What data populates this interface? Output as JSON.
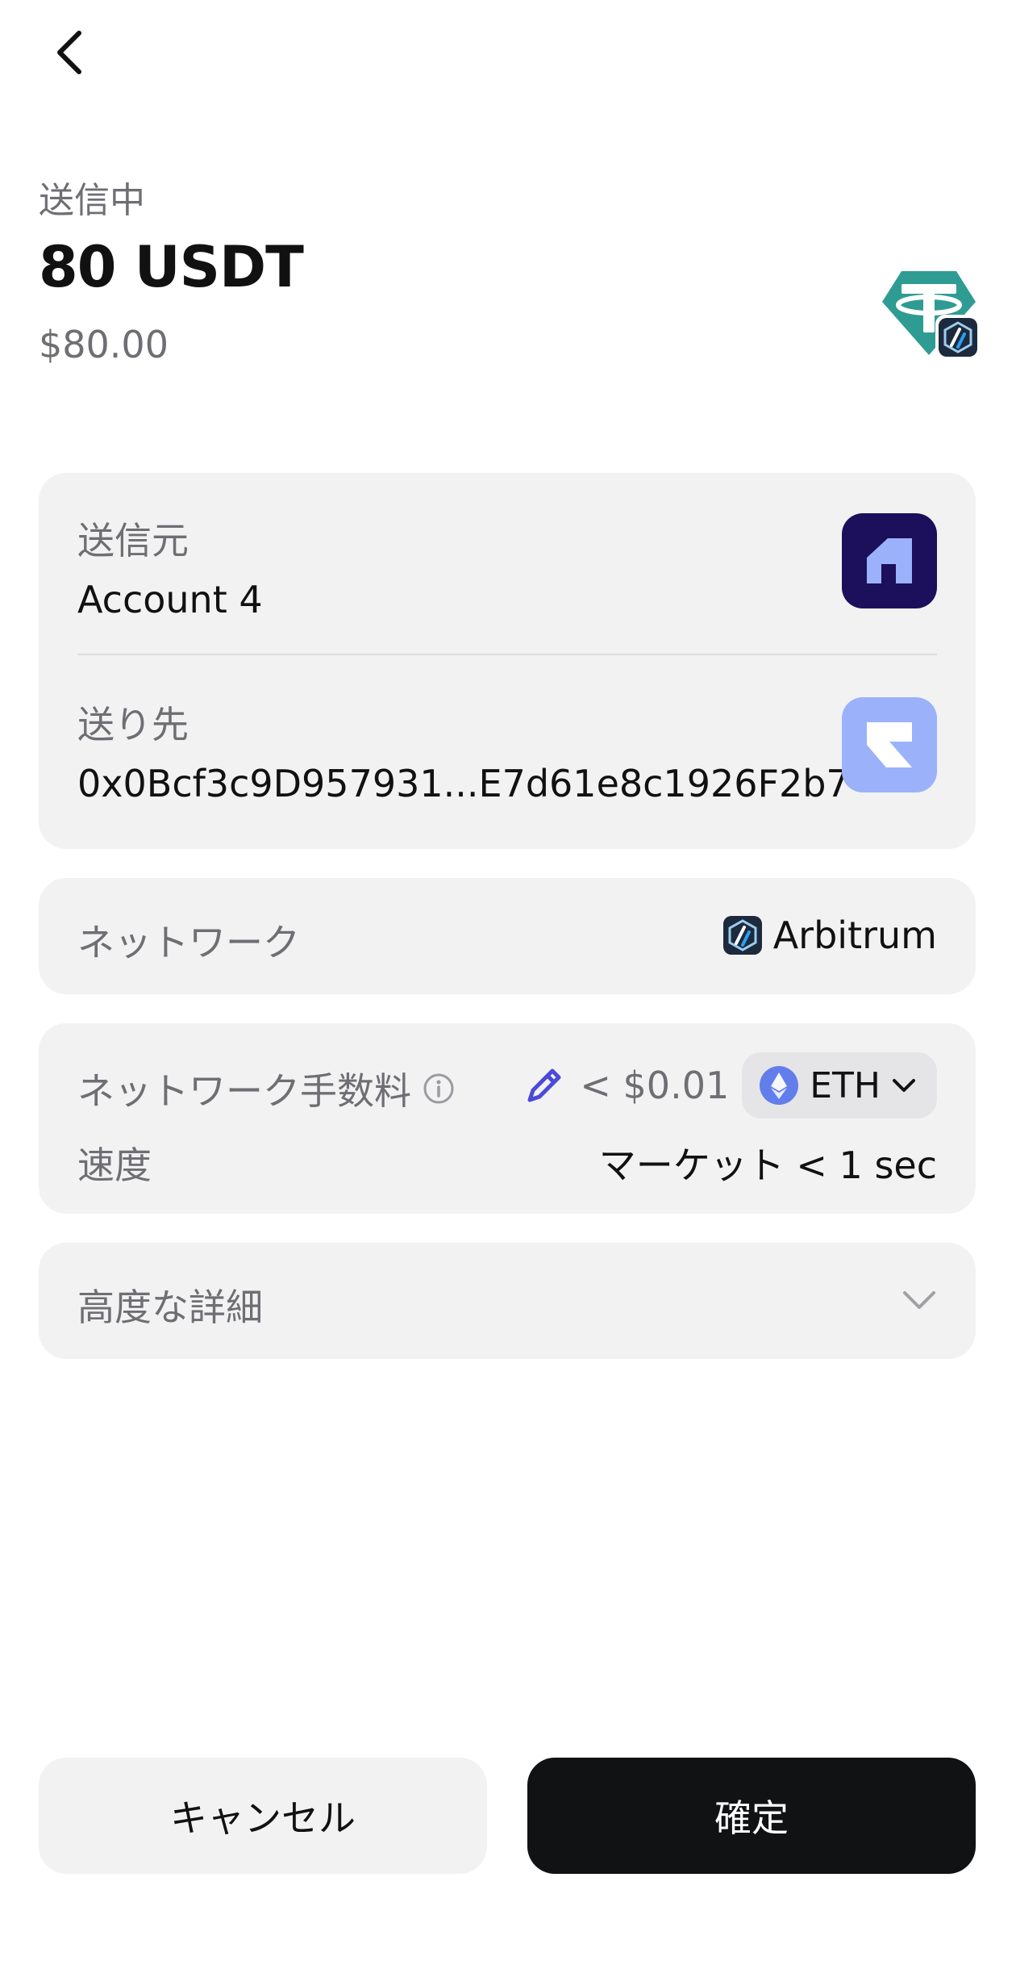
{
  "header": {
    "label": "送信中",
    "amount": "80 USDT",
    "fiat": "$80.00"
  },
  "token": {
    "icon": "tether-icon",
    "chain_icon": "arbitrum-icon",
    "color": "#2f9c93"
  },
  "from": {
    "label": "送信元",
    "value": "Account 4",
    "avatar_color": "#1c0f5c"
  },
  "to": {
    "label": "送り先",
    "value": "0x0Bcf3c9D957931...E7d61e8c1926F2b7",
    "avatar_color": "#9bb2fb"
  },
  "network": {
    "label": "ネットワーク",
    "value": "Arbitrum"
  },
  "fee": {
    "label": "ネットワーク手数料",
    "amount": "< $0.01",
    "currency": "ETH",
    "speed_label": "速度",
    "speed_value": "マーケット < 1 sec",
    "edit_color": "#4b4ad9"
  },
  "advanced": {
    "label": "高度な詳細"
  },
  "actions": {
    "cancel": "キャンセル",
    "confirm": "確定"
  }
}
